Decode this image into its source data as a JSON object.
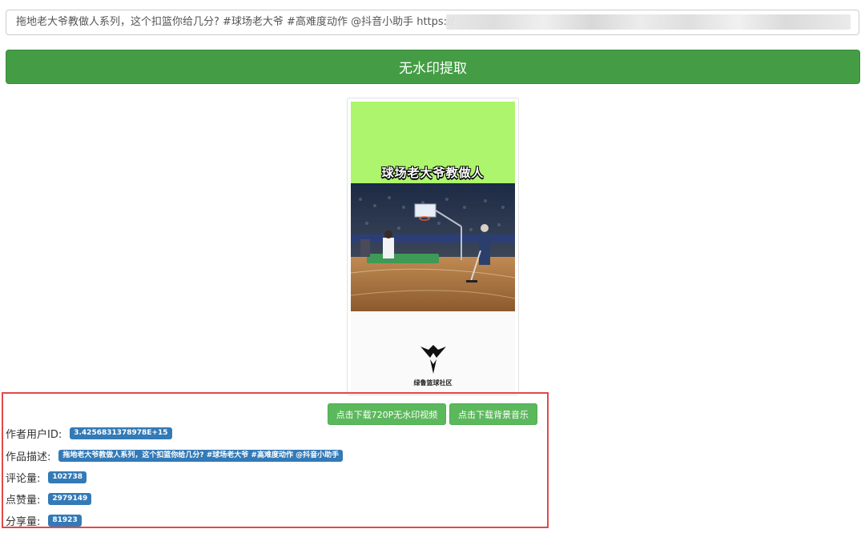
{
  "input": {
    "value": "拖地老大爷教做人系列，这个扣篮你给几分? #球场老大爷 #高难度动作 @抖音小助手 https://"
  },
  "extract_button": {
    "label": "无水印提取"
  },
  "thumbnail": {
    "overlay_text": "球场老大爷教做人",
    "logo_text": "绿鲁篮球社区",
    "top_color": "#acf56d"
  },
  "buttons": {
    "download_video": "点击下载720P无水印视频",
    "download_music": "点击下载背景音乐"
  },
  "info": {
    "author_id_label": "作者用户ID:",
    "author_id_value": "3.4256831378978E+15",
    "description_label": "作品描述:",
    "description_value": "拖地老大爷教做人系列，这个扣篮你给几分? #球场老大爷 #高难度动作 @抖音小助手",
    "comments_label": "评论量:",
    "comments_value": "102738",
    "likes_label": "点赞量:",
    "likes_value": "2979149",
    "shares_label": "分享量:",
    "shares_value": "81923"
  },
  "colors": {
    "primary_green": "#449d44",
    "button_green": "#5cb85c",
    "badge_blue": "#337ab7",
    "highlight_red": "#e04a4a"
  }
}
